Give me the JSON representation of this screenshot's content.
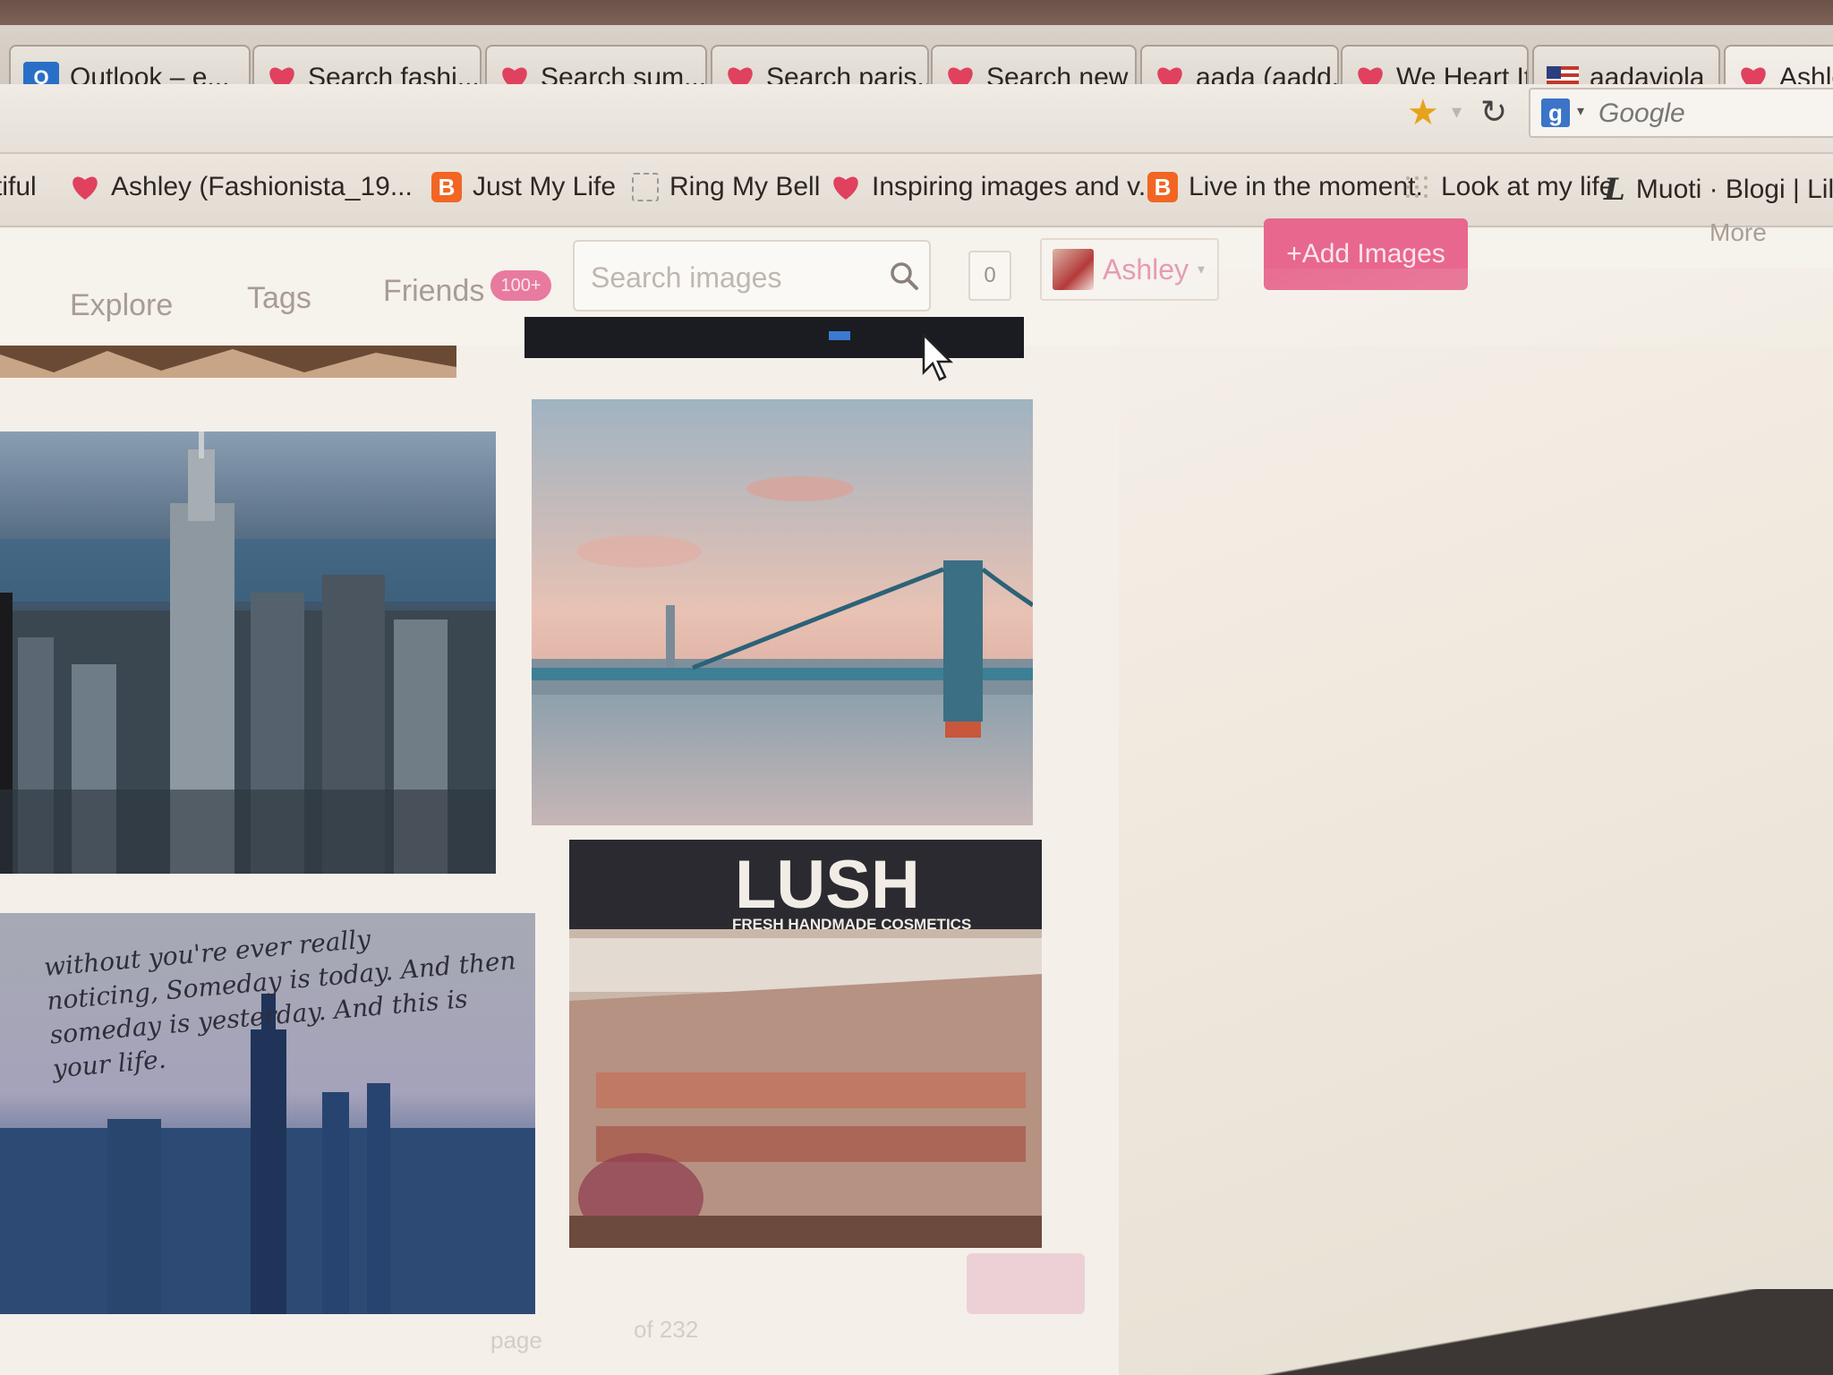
{
  "tabs": [
    {
      "label": "Outlook – e...",
      "icon": "outlook-icon"
    },
    {
      "label": "Search fashi...",
      "icon": "heart-icon"
    },
    {
      "label": "Search sum...",
      "icon": "heart-icon"
    },
    {
      "label": "Search paris...",
      "icon": "heart-icon"
    },
    {
      "label": "Search new ...",
      "icon": "heart-icon"
    },
    {
      "label": "aada (aadd...",
      "icon": "heart-icon"
    },
    {
      "label": "We Heart It |...",
      "icon": "heart-icon"
    },
    {
      "label": "aadaviola",
      "icon": "flag-icon"
    },
    {
      "label": "Ashley",
      "icon": "heart-icon"
    }
  ],
  "navbar": {
    "search_engine_placeholder": "Google"
  },
  "bookmarks": [
    {
      "label": "tiful",
      "icon": ""
    },
    {
      "label": "Ashley (Fashionista_19...",
      "icon": "heart-icon"
    },
    {
      "label": "Just My Life",
      "icon": "blogger-icon"
    },
    {
      "label": "Ring My Bell",
      "icon": "bell-icon"
    },
    {
      "label": "Inspiring images and v...",
      "icon": "heart-icon"
    },
    {
      "label": "Live in the moment.",
      "icon": "blogger-icon"
    },
    {
      "label": "Look at my life",
      "icon": "grid-icon"
    },
    {
      "label": "Muoti · Blogi | Lily",
      "icon": "l-icon"
    }
  ],
  "site": {
    "nav": {
      "explore": "Explore",
      "tags": "Tags",
      "friends": "Friends",
      "friends_badge": "100+"
    },
    "search_placeholder": "Search images",
    "notification_count": "0",
    "user_name": "Ashley",
    "add_images": "+Add Images",
    "more": "More"
  },
  "images": [
    {
      "name": "empire-state-aerial",
      "overlay_text": ""
    },
    {
      "name": "manhattan-bridge",
      "overlay_text": ""
    },
    {
      "name": "quote-skyline",
      "overlay_text": "without you're ever really noticing, Someday is today. And then someday is yesterday. And this is your life."
    },
    {
      "name": "lush-store",
      "overlay_text": "LUSH",
      "overlay_subtext": "FRESH HANDMADE COSMETICS"
    }
  ],
  "pagination": {
    "page_label": "page",
    "of_label": "of 232"
  },
  "colors": {
    "accent_pink": "#e8678f",
    "heart_red": "#e0415e"
  }
}
